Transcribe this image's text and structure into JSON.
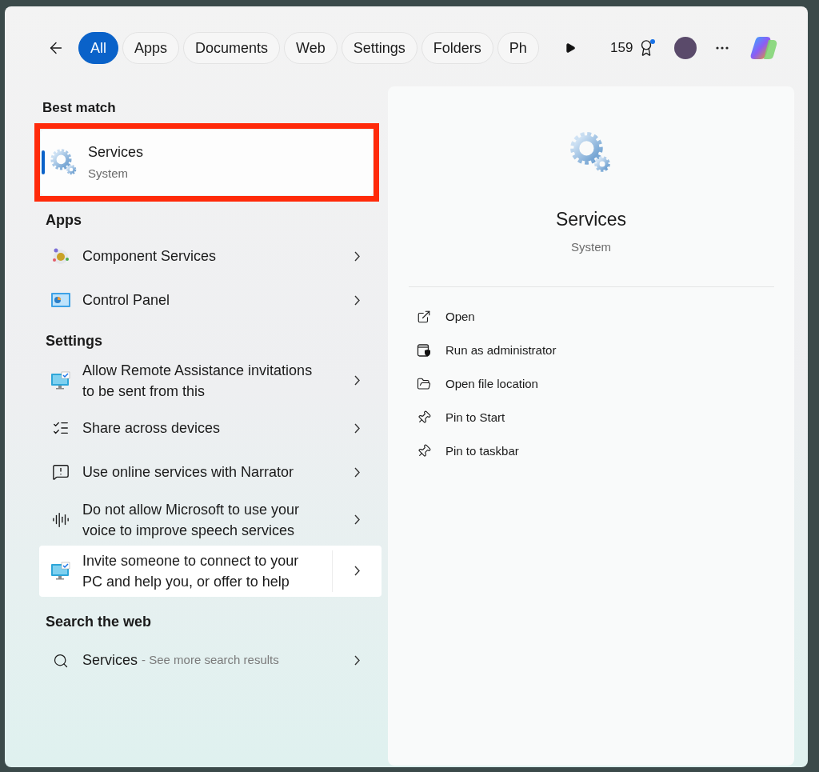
{
  "toolbar": {
    "filters": [
      {
        "label": "All",
        "selected": true
      },
      {
        "label": "Apps",
        "selected": false
      },
      {
        "label": "Documents",
        "selected": false
      },
      {
        "label": "Web",
        "selected": false
      },
      {
        "label": "Settings",
        "selected": false
      },
      {
        "label": "Folders",
        "selected": false
      },
      {
        "label": "Ph",
        "selected": false
      }
    ],
    "points": "159"
  },
  "best_match": {
    "heading": "Best match",
    "title": "Services",
    "subtitle": "System",
    "selected": true,
    "annotated": true
  },
  "groups": [
    {
      "heading": "Apps",
      "items": [
        {
          "kind": "component",
          "label": "Component Services",
          "hovered": false
        },
        {
          "kind": "control-panel",
          "label": "Control Panel",
          "hovered": false
        }
      ]
    },
    {
      "heading": "Settings",
      "items": [
        {
          "kind": "remote",
          "label": "Allow Remote Assistance invitations to be sent from this",
          "hovered": false
        },
        {
          "kind": "list",
          "label": "Share across devices",
          "hovered": false
        },
        {
          "kind": "narrator",
          "label": "Use online services with Narrator",
          "hovered": false
        },
        {
          "kind": "voice",
          "label": "Do not allow Microsoft to use your voice to improve speech services",
          "hovered": false
        },
        {
          "kind": "remote",
          "label": "Invite someone to connect to your PC and help you, or offer to help",
          "hovered": true
        }
      ]
    }
  ],
  "web": {
    "heading": "Search the web",
    "query": "Services",
    "hint": "- See more search results"
  },
  "details": {
    "title": "Services",
    "subtitle": "System",
    "actions": [
      {
        "kind": "open",
        "label": "Open"
      },
      {
        "kind": "admin",
        "label": "Run as administrator"
      },
      {
        "kind": "folder",
        "label": "Open file location"
      },
      {
        "kind": "pin",
        "label": "Pin to Start"
      },
      {
        "kind": "pin",
        "label": "Pin to taskbar"
      }
    ]
  }
}
